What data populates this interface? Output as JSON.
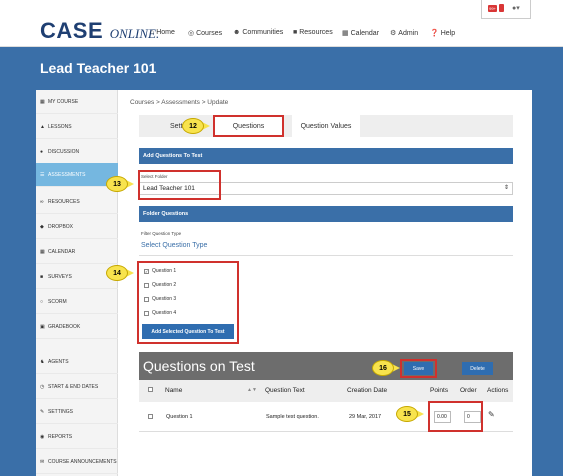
{
  "brand": {
    "logo_main": "CASE",
    "logo_sub": "ONLINE."
  },
  "nav": {
    "home": "Home",
    "courses": "Courses",
    "communities": "Communities",
    "resources": "Resources",
    "calendar": "Calendar",
    "admin": "Admin",
    "help": "Help"
  },
  "notification": {
    "badge": "99+"
  },
  "page_title": "Lead Teacher 101",
  "sidebar": {
    "items": [
      {
        "label": "My Course",
        "icon": "grid-icon"
      },
      {
        "label": "Lessons",
        "icon": "book-icon"
      },
      {
        "label": "Discussion",
        "icon": "chat-icon"
      },
      {
        "label": "Assessments",
        "icon": "list-icon",
        "active": true
      },
      {
        "label": "Resources",
        "icon": "link-icon"
      },
      {
        "label": "Dropbox",
        "icon": "dropbox-icon"
      },
      {
        "label": "Calendar",
        "icon": "calendar-icon"
      },
      {
        "label": "Surveys",
        "icon": "survey-icon"
      },
      {
        "label": "SCORM",
        "icon": "scorm-icon"
      },
      {
        "label": "Gradebook",
        "icon": "gradebook-icon"
      },
      {
        "label": "Agents",
        "icon": "agent-icon"
      },
      {
        "label": "Start & End Dates",
        "icon": "clock-icon"
      },
      {
        "label": "Settings",
        "icon": "wrench-icon"
      },
      {
        "label": "Reports",
        "icon": "report-icon"
      },
      {
        "label": "Course Announcements",
        "icon": "megaphone-icon"
      }
    ]
  },
  "breadcrumb": "Courses > Assessments > Update",
  "tabs": {
    "settings": "Setti",
    "questions": "Questions",
    "question_values": "Question Values"
  },
  "add_section": {
    "title": "Add Questions To Test",
    "select_folder_label": "Select Folder",
    "folder_value": "Lead Teacher 101",
    "folder_questions_title": "Folder Questions",
    "filter_label": "Filter Question Type",
    "select_question_type": "Select Question Type",
    "questions": [
      {
        "label": "Question 1",
        "checked": true
      },
      {
        "label": "Question 2",
        "checked": false
      },
      {
        "label": "Question 3",
        "checked": false
      },
      {
        "label": "Question 4",
        "checked": false
      }
    ],
    "add_button": "Add Selected Question To Test"
  },
  "questions_on_test": {
    "title": "Questions on Test",
    "save": "Save",
    "delete": "Delete",
    "columns": {
      "name": "Name",
      "question_text": "Question Text",
      "creation_date": "Creation Date",
      "points": "Points",
      "order": "Order",
      "actions": "Actions"
    },
    "rows": [
      {
        "name": "Question 1",
        "question_text": "Sample test question.",
        "creation_date": "29 Mar, 2017",
        "points": "0.00",
        "order": "0"
      }
    ]
  },
  "callouts": {
    "c12": "12",
    "c13": "13",
    "c14": "14",
    "c15": "15",
    "c16": "16"
  },
  "colors": {
    "brand_blue": "#3a6fa8",
    "active_side": "#75b7e0",
    "highlight_red": "#d0312d",
    "callout_yellow": "#f8e34d"
  }
}
